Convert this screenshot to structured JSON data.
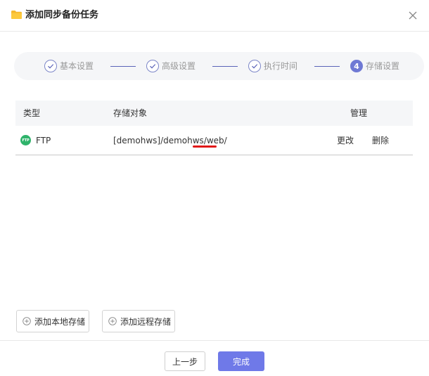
{
  "dialog": {
    "title": "添加同步备份任务",
    "close_icon": "close-icon",
    "folder_icon": "folder-icon"
  },
  "steps": [
    {
      "label": "基本设置",
      "state": "done"
    },
    {
      "label": "高级设置",
      "state": "done"
    },
    {
      "label": "执行时间",
      "state": "done"
    },
    {
      "label": "存储设置",
      "state": "active",
      "number": "4"
    }
  ],
  "colors": {
    "accent": "#6f79e8",
    "ftp_badge": "#2fb36b",
    "annotation": "#e01818"
  },
  "table": {
    "headers": {
      "type": "类型",
      "target": "存储对象",
      "manage": "管理"
    },
    "rows": [
      {
        "badge": "FTP",
        "type": "FTP",
        "target": "[demohws]/demohws/web/",
        "edit": "更改",
        "delete": "删除"
      }
    ]
  },
  "actions": {
    "add_local": "添加本地存储",
    "add_remote": "添加远程存储"
  },
  "footer": {
    "prev": "上一步",
    "done": "完成"
  }
}
